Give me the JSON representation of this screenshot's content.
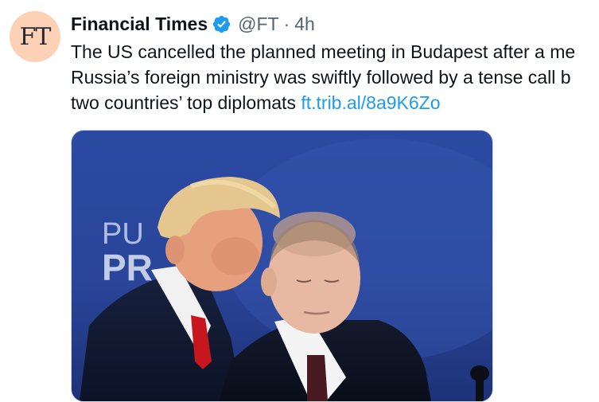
{
  "tweet": {
    "avatar_text": "FT",
    "display_name": "Financial Times",
    "verified_icon": "verified-badge-icon",
    "handle": "@FT",
    "separator": "·",
    "time": "4h",
    "text_lines": [
      "The US cancelled the planned meeting in Budapest after a me",
      "Russia’s foreign ministry was swiftly followed by a tense call b",
      "two countries’ top diplomats "
    ],
    "link_text": "ft.trib.al/8a9K6Zo",
    "media": {
      "backdrop_text_1": "PU",
      "backdrop_text_2": "PR"
    }
  },
  "colors": {
    "link": "#1d9bf0",
    "verified": "#1d9bf0",
    "avatar_bg": "#fcd1b6",
    "secondary_text": "#536471"
  }
}
